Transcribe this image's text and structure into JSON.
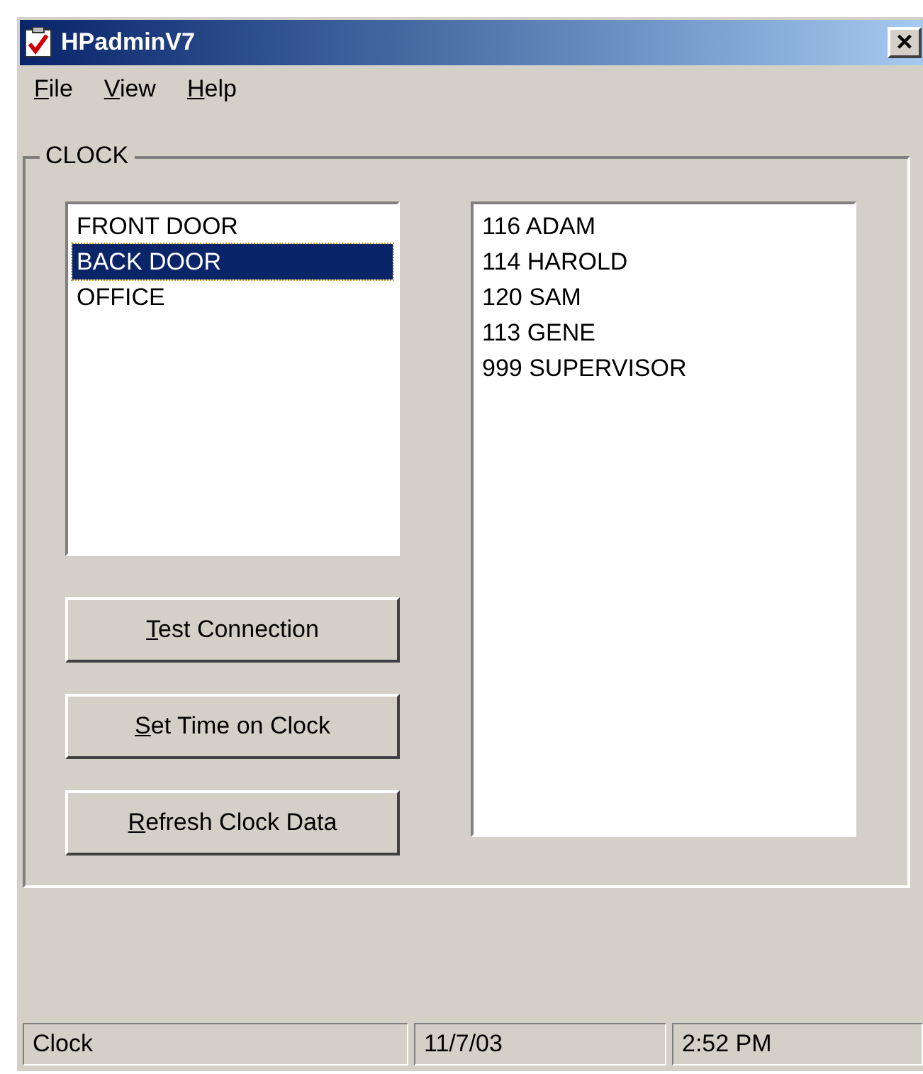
{
  "window": {
    "title": "HPadminV7",
    "close": "×"
  },
  "menu": [
    "File",
    "View",
    "Help"
  ],
  "group": {
    "title": "CLOCK"
  },
  "clocks": [
    {
      "label": "FRONT DOOR",
      "selected": false
    },
    {
      "label": "BACK DOOR",
      "selected": true
    },
    {
      "label": "OFFICE",
      "selected": false
    }
  ],
  "buttons": [
    "Test Connection",
    "Set Time on Clock",
    "Refresh Clock Data"
  ],
  "employees": [
    "116 ADAM",
    "114 HAROLD",
    "120 SAM",
    "113 GENE",
    "999 SUPERVISOR"
  ],
  "status_bar": [
    "Clock",
    "11/7/03",
    "2:52 PM"
  ]
}
